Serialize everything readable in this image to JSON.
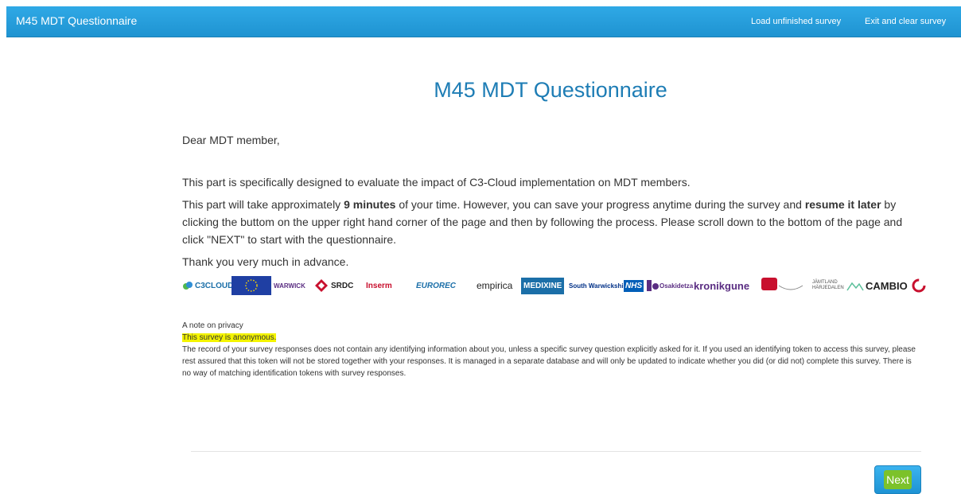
{
  "header": {
    "app_title": "M45 MDT Questionnaire",
    "load_link": "Load unfinished survey",
    "exit_link": "Exit and clear survey"
  },
  "main": {
    "title": "M45 MDT Questionnaire",
    "greeting": "Dear MDT member,",
    "para1": "This part is specifically designed to evaluate the impact of C3-Cloud implementation on MDT members.",
    "para2_a": "This part will take approximately ",
    "para2_b": "9 minutes",
    "para2_c": " of your time. However, you can save your progress anytime during the survey and ",
    "para2_d": "resume it later",
    "para2_e": " by clicking the buttom on the upper right hand corner of the page and then by following the process. Please scroll down to the bottom of the page and click \"NEXT\" to start with the questionnaire.",
    "thanks": "Thank you very much in advance.",
    "logos": [
      {
        "name": "C3CLOUD",
        "color": "#1b6fa8"
      },
      {
        "name": "WARWICK",
        "color": "#5a2d82"
      },
      {
        "name": "SRDC",
        "color": "#222222"
      },
      {
        "name": "Inserm",
        "color": "#c8102e"
      },
      {
        "name": "EUROREC",
        "color": "#1b6fa8"
      },
      {
        "name": "empirica",
        "color": "#222222"
      },
      {
        "name": "MEDIXINE",
        "color": "#1b6fa8"
      },
      {
        "name": "South Warwickshire",
        "color": "#003087"
      },
      {
        "name": "NHS",
        "color": "#005eb8"
      },
      {
        "name": "Osakidetza",
        "color": "#5a2d82"
      },
      {
        "name": "kronikgune",
        "color": "#5a2d82"
      },
      {
        "name": "JÄMTLAND HÄRJEDALEN",
        "color": "#555555"
      },
      {
        "name": "CAMBIO",
        "color": "#222222"
      }
    ]
  },
  "privacy": {
    "heading": "A note on privacy",
    "anon": "This survey is anonymous.",
    "body": "The record of your survey responses does not contain any identifying information about you, unless a specific survey question explicitly asked for it. If you used an identifying token to access this survey, please rest assured that this token will not be stored together with your responses. It is managed in a separate database and will only be updated to indicate whether you did (or did not) complete this survey. There is no way of matching identification tokens with survey responses."
  },
  "footer": {
    "next_label": "Next"
  },
  "colors": {
    "accent": "#1f93d1",
    "title": "#1e7db5",
    "highlight": "#f4f400",
    "next_highlight": "#7cc22a"
  }
}
